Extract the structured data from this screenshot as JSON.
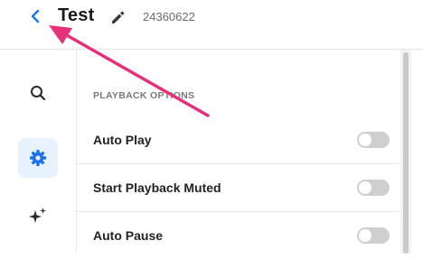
{
  "header": {
    "back_icon": "chevron-left-icon",
    "title": "Test",
    "edit_icon": "pencil-icon",
    "id": "24360622"
  },
  "rail": {
    "items": [
      {
        "icon": "search-icon",
        "active": false
      },
      {
        "icon": "gear-icon",
        "active": true
      },
      {
        "icon": "sparkles-icon",
        "active": false
      }
    ]
  },
  "panel": {
    "section_title": "PLAYBACK OPTIONS",
    "options": [
      {
        "label": "Auto Play",
        "enabled": false
      },
      {
        "label": "Start Playback Muted",
        "enabled": false
      },
      {
        "label": "Auto Pause",
        "enabled": false
      }
    ]
  },
  "colors": {
    "accent": "#1a73e8",
    "active_bg": "#e8f1fe",
    "toggle_off": "#cfcfcf",
    "annotation": "#e5307a"
  }
}
